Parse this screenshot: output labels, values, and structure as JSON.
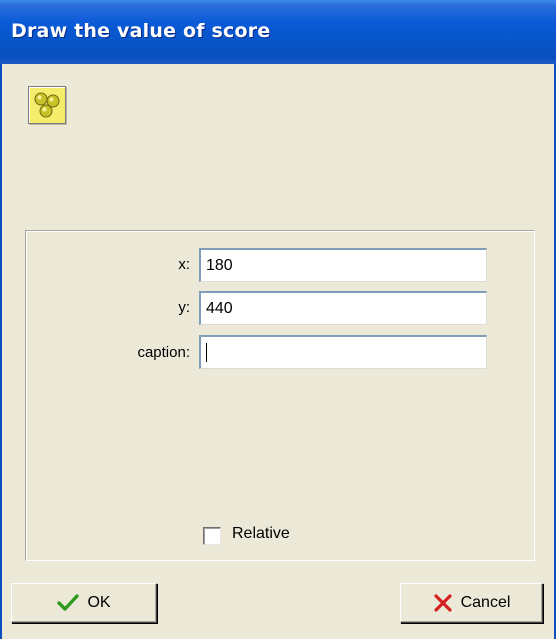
{
  "window": {
    "title": "Draw the value of score"
  },
  "action_icon": {
    "name": "score-balls-icon",
    "color": "#f4ec6a"
  },
  "fields": {
    "x": {
      "label": "x:",
      "value": "180"
    },
    "y": {
      "label": "y:",
      "value": "440"
    },
    "caption": {
      "label": "caption:",
      "value": ""
    }
  },
  "relative": {
    "label": "Relative",
    "checked": false
  },
  "buttons": {
    "ok": {
      "label": "OK",
      "icon": "checkmark-icon",
      "icon_color": "#2e9a1e"
    },
    "cancel": {
      "label": "Cancel",
      "icon": "x-cross-icon",
      "icon_color": "#d42020"
    }
  },
  "colors": {
    "titlebar": "#0a5ad8",
    "dialog_background": "#ece9d8",
    "input_border": "#7f9db9"
  }
}
